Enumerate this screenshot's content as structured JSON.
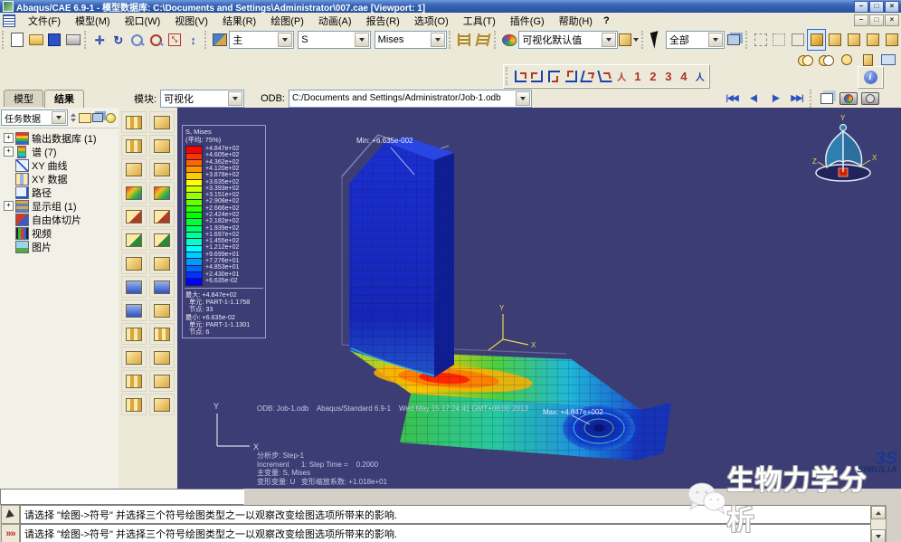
{
  "window": {
    "title": "Abaqus/CAE 6.9-1 - 模型数据库: C:\\Documents and Settings\\Administrator\\007.cae [Viewport: 1]",
    "minimize": "–",
    "maximize": "□",
    "close": "×"
  },
  "menubar": {
    "items": [
      "文件(F)",
      "模型(M)",
      "视口(W)",
      "视图(V)",
      "结果(R)",
      "绘图(P)",
      "动画(A)",
      "报告(R)",
      "选项(O)",
      "工具(T)",
      "插件(G)",
      "帮助(H)"
    ],
    "context_help": "?"
  },
  "toolbar1": {
    "plot_state": "主",
    "field_variable": "S",
    "invariant": "Mises",
    "color_mapping": "可视化默认值",
    "selection_filter": "全部"
  },
  "viewbar": {
    "numbers": [
      "1",
      "2",
      "3",
      "4"
    ]
  },
  "infobtn": {
    "glyph": "i"
  },
  "contextbar": {
    "module_label": "模块:",
    "module_value": "可视化",
    "odb_label": "ODB:",
    "odb_value": "C:/Documents and Settings/Administrator/Job-1.odb",
    "play_first": "|◀◀",
    "play_prev": "◀|",
    "play_next": "|▶",
    "play_last": "▶▶|"
  },
  "treepanel": {
    "tabs": {
      "model": "模型",
      "results": "结果"
    },
    "filter_combo": "任务数据",
    "items": [
      {
        "expand": "+",
        "icon": "odb",
        "label": "输出数据库 (1)"
      },
      {
        "expand": "+",
        "icon": "spec",
        "label": "谱 (7)"
      },
      {
        "expand": "",
        "icon": "xyc",
        "label": "XY 曲线"
      },
      {
        "expand": "",
        "icon": "xyd",
        "label": "XY 数据"
      },
      {
        "expand": "",
        "icon": "path",
        "label": "路径"
      },
      {
        "expand": "+",
        "icon": "dg",
        "label": "显示组 (1)"
      },
      {
        "expand": "",
        "icon": "fbs",
        "label": "自由体切片"
      },
      {
        "expand": "",
        "icon": "video",
        "label": "视频"
      },
      {
        "expand": "",
        "icon": "img",
        "label": "图片"
      }
    ]
  },
  "toolbox": {
    "buttons": [
      {
        "g": "g1",
        "n": "field-output"
      },
      {
        "g": "g0",
        "n": "frame-selector"
      },
      {
        "g": "g1",
        "n": "result-options"
      },
      {
        "g": "g0",
        "n": "section-points"
      },
      {
        "g": "g0",
        "n": "plot-undeformed"
      },
      {
        "g": "g0",
        "n": "plot-deformed"
      },
      {
        "g": "g2",
        "n": "plot-contour"
      },
      {
        "g": "g2",
        "n": "contour-options"
      },
      {
        "g": "g4",
        "n": "plot-symbol"
      },
      {
        "g": "g4",
        "n": "symbol-options"
      },
      {
        "g": "g5",
        "n": "plot-material-orientation"
      },
      {
        "g": "g5",
        "n": "orientation-options"
      },
      {
        "g": "g0",
        "n": "allow-multiple-plot-states"
      },
      {
        "g": "g0",
        "n": "plot-options"
      },
      {
        "g": "g3",
        "n": "animate-time-history"
      },
      {
        "g": "g3",
        "n": "animate-scale-factor"
      },
      {
        "g": "g3",
        "n": "animate-harmonic"
      },
      {
        "g": "g0",
        "n": "animation-options"
      },
      {
        "g": "g1",
        "n": "create-xy-data"
      },
      {
        "g": "g1",
        "n": "xy-options"
      },
      {
        "g": "g0",
        "n": "query-information"
      },
      {
        "g": "g0",
        "n": "view-cut"
      },
      {
        "g": "g1",
        "n": "create-path"
      },
      {
        "g": "g0",
        "n": "display-group"
      },
      {
        "g": "g1",
        "n": "free-body-cut"
      },
      {
        "g": "g0",
        "n": "stream-options"
      }
    ]
  },
  "legend": {
    "title": "S, Mises",
    "subtitle": "(平均: 75%)",
    "items": [
      {
        "v": "+4.847e+02",
        "c": "#ff0000"
      },
      {
        "v": "+4.605e+02",
        "c": "#ff3300"
      },
      {
        "v": "+4.362e+02",
        "c": "#ff6600"
      },
      {
        "v": "+4.120e+02",
        "c": "#ff9900"
      },
      {
        "v": "+3.878e+02",
        "c": "#ffcc00"
      },
      {
        "v": "+3.635e+02",
        "c": "#ffff00"
      },
      {
        "v": "+3.393e+02",
        "c": "#ccff00"
      },
      {
        "v": "+3.151e+02",
        "c": "#99ff00"
      },
      {
        "v": "+2.908e+02",
        "c": "#66ff00"
      },
      {
        "v": "+2.666e+02",
        "c": "#33ff00"
      },
      {
        "v": "+2.424e+02",
        "c": "#00ff00"
      },
      {
        "v": "+2.182e+02",
        "c": "#00ff33"
      },
      {
        "v": "+1.939e+02",
        "c": "#00ff66"
      },
      {
        "v": "+1.697e+02",
        "c": "#00ff99"
      },
      {
        "v": "+1.455e+02",
        "c": "#00ffcc"
      },
      {
        "v": "+1.212e+02",
        "c": "#00ffff"
      },
      {
        "v": "+9.699e+01",
        "c": "#00ccff"
      },
      {
        "v": "+7.276e+01",
        "c": "#0099ff"
      },
      {
        "v": "+4.853e+01",
        "c": "#0066ff"
      },
      {
        "v": "+2.430e+01",
        "c": "#0033ff"
      },
      {
        "v": "+6.635e-02",
        "c": "#0000ff"
      }
    ],
    "maxmin": [
      "最大: +4.847e+02",
      "  单元: PART-1-1.1758",
      "  节点: 33",
      "最小: +6.635e-02",
      "  单元: PART-1-1.1301",
      "  节点: 6"
    ]
  },
  "viewport": {
    "min_annotation": "Min: +6.635e-002",
    "max_annotation": "Max: +4.847e+002",
    "odb_line": "ODB: Job-1.odb    Abaqus/Standard 6.9-1    Wed May 15 17:24:41 GMT+08:00 2013",
    "state_lines": [
      "分析步: Step-1",
      "Increment      1: Step Time =    0.2000",
      "主变量: S, Mises",
      "变形变量: U   变形缩放系数: +1.018e+01"
    ],
    "triad": {
      "x": "X",
      "y": "Y"
    },
    "compass": {
      "x": "X",
      "y": "Y",
      "z": "Z"
    }
  },
  "status": {
    "messages": [
      "请选择 \"绘图->符号\" 并选择三个符号绘图类型之一以观察改变绘图选项所带来的影响.",
      "请选择 \"绘图->符号\" 并选择三个符号绘图类型之一以观察改变绘图选项所带来的影响."
    ],
    "more_glyph": "»»"
  },
  "watermark": {
    "text": "生物力学分析",
    "logo_swoosh": "3S",
    "logo_brand": "SIMULIA"
  }
}
